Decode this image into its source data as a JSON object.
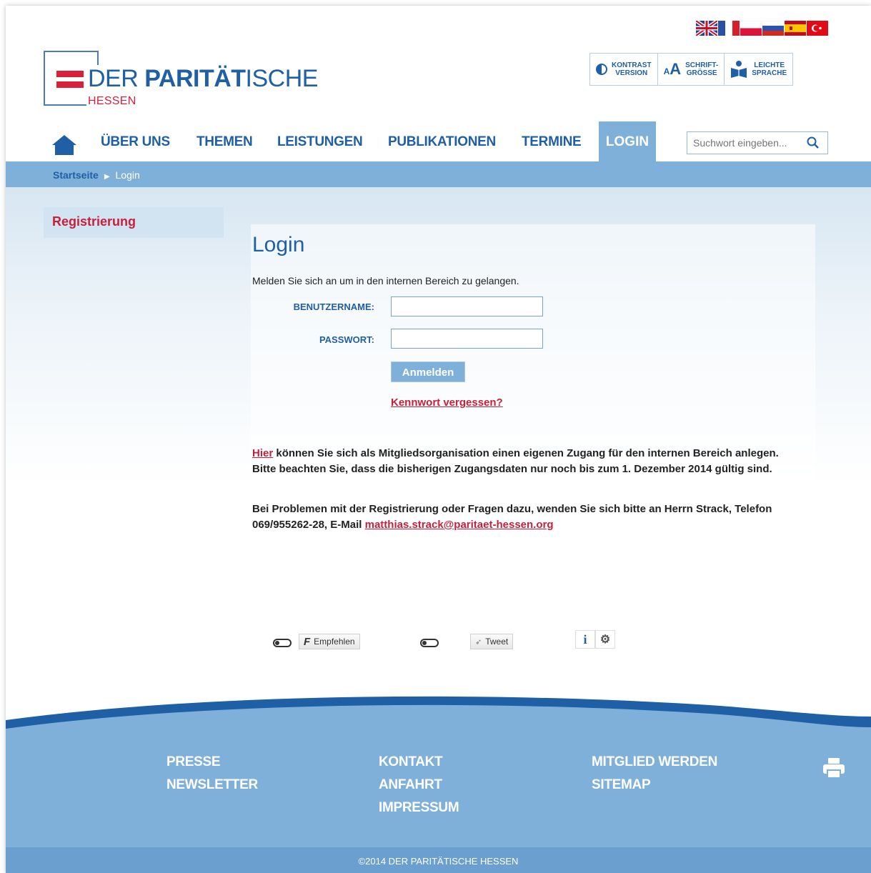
{
  "header": {
    "languages": [
      "English",
      "Français",
      "Polski",
      "Русский",
      "Español",
      "Türkçe"
    ],
    "logo": {
      "brand_light": "DER ",
      "brand_bold": "PARITÄT",
      "brand_end": "ISCHE",
      "sub": "HESSEN"
    },
    "accessibility": {
      "kontrast_l1": "KONTRAST",
      "kontrast_l2": "VERSION",
      "schrift_l1": "SCHRIFT-",
      "schrift_l2": "GRÖSSE",
      "leicht_l1": "LEICHTE",
      "leicht_l2": "SPRACHE"
    }
  },
  "nav": {
    "items": [
      "ÜBER UNS",
      "THEMEN",
      "LEISTUNGEN",
      "PUBLIKATIONEN",
      "TERMINE"
    ],
    "active": "LOGIN",
    "search_placeholder": "Suchwort eingeben..."
  },
  "breadcrumb": {
    "home": "Startseite",
    "current": "Login"
  },
  "sidebar": {
    "registration": "Registrierung"
  },
  "login": {
    "title": "Login",
    "intro": "Melden Sie sich an um in den internen Bereich zu gelangen.",
    "username_label": "BENUTZERNAME:",
    "password_label": "PASSWORT:",
    "submit": "Anmelden",
    "forgot": "Kennwort vergessen?"
  },
  "info": {
    "p1_link": "Hier",
    "p1_text": " können Sie sich als Mitgliedsorganisation einen eigenen Zugang für den internen Bereich anlegen. Bitte beachten Sie, dass die bisherigen Zugangsdaten nur noch bis zum 1. Dezember 2014 gültig sind.",
    "p2_text": "Bei Problemen mit der Registrierung oder Fragen dazu, wenden Sie sich bitte an Herrn Strack, Telefon 069/955262-28, E-Mail ",
    "p2_email": "matthias.strack@paritaet-hessen.org"
  },
  "social": {
    "facebook": "Empfehlen",
    "twitter": "Tweet"
  },
  "footer": {
    "col1": [
      "PRESSE",
      "NEWSLETTER"
    ],
    "col2": [
      "KONTAKT",
      "ANFAHRT",
      "IMPRESSUM"
    ],
    "col3": [
      "MITGLIED WERDEN",
      "SITEMAP"
    ],
    "copyright": "©2014 DER PARITÄTISCHE HESSEN"
  },
  "colors": {
    "brand_blue": "#1f5fa6",
    "brand_red": "#d81f3c",
    "nav_blue": "#7fb0d9"
  }
}
